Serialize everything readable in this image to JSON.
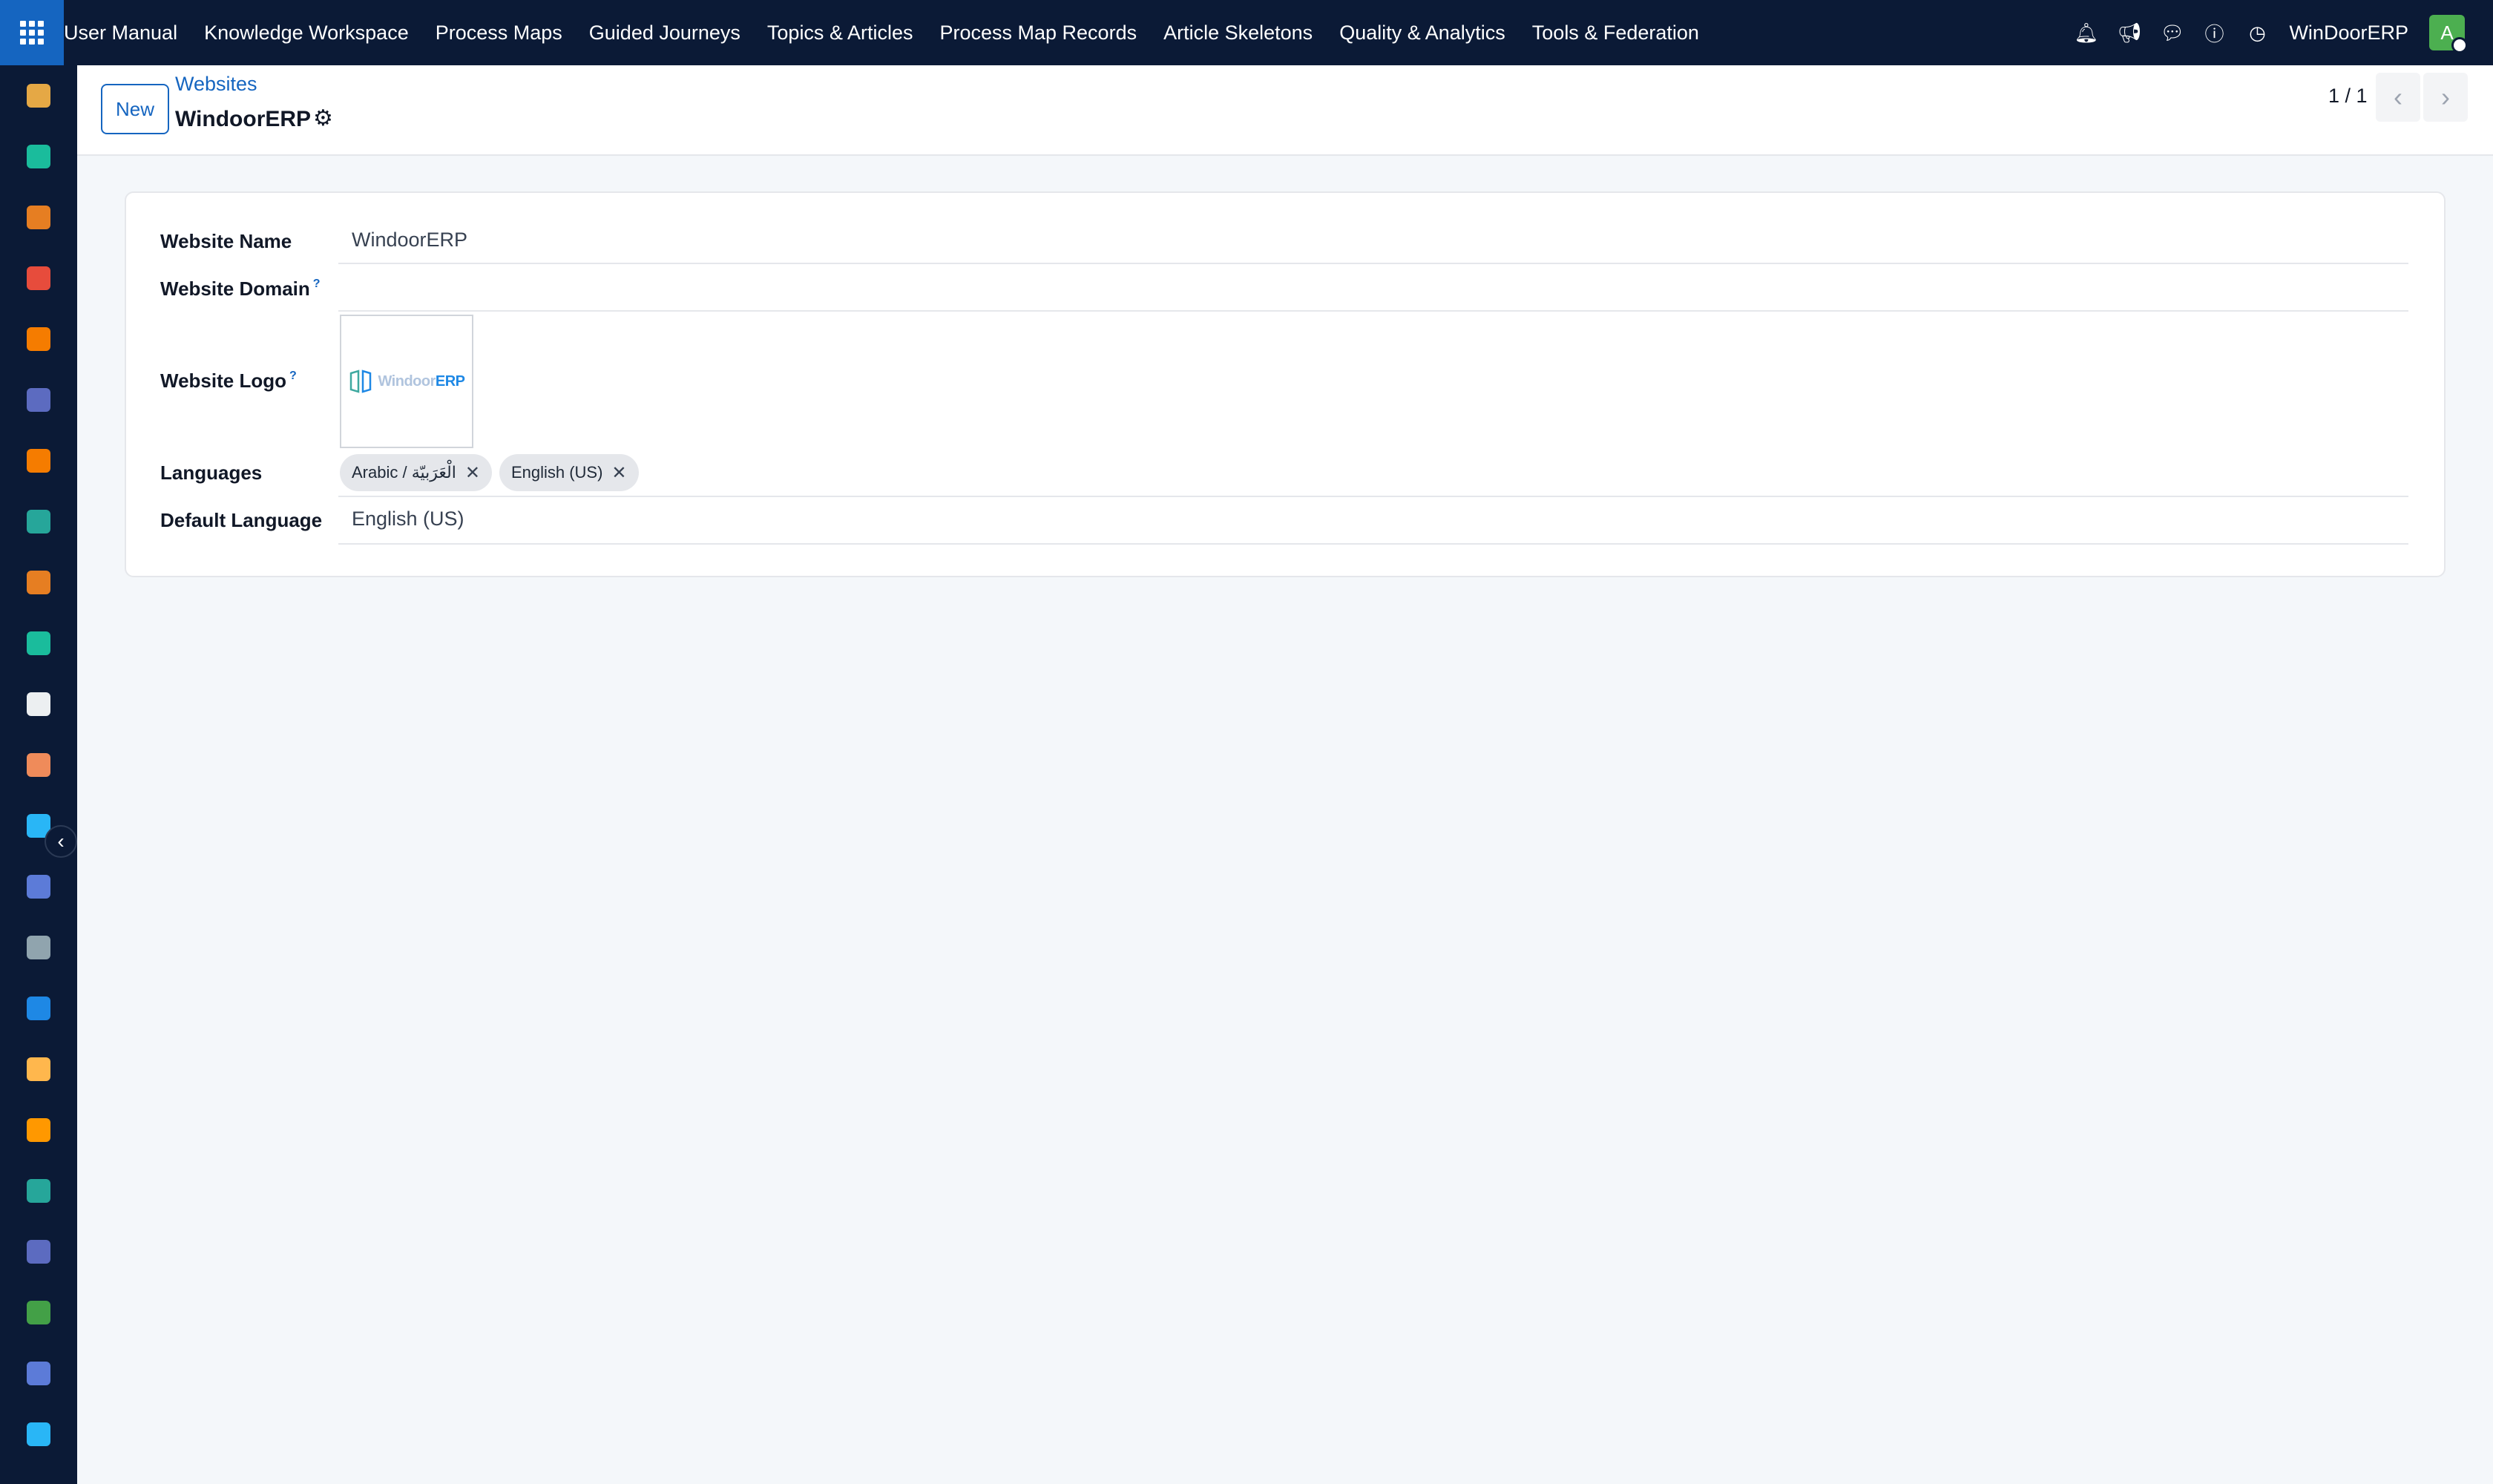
{
  "navbar": {
    "menu": [
      "User Manual",
      "Knowledge Workspace",
      "Process Maps",
      "Guided Journeys",
      "Topics & Articles",
      "Process Map Records",
      "Article Skeletons",
      "Quality & Analytics",
      "Tools & Federation"
    ],
    "company": "WinDoorERP",
    "avatar_letter": "A",
    "icons": [
      "bell-icon",
      "megaphone-icon",
      "chat-icon",
      "help-icon",
      "clock-icon"
    ]
  },
  "sidebar": {
    "apps": [
      {
        "icon": "mixed-app-icon",
        "color": "#e5a845"
      },
      {
        "icon": "contacts-icon",
        "color": "#1abc9c"
      },
      {
        "icon": "reporting-icon",
        "color": "#e67e22"
      },
      {
        "icon": "pie-icon",
        "color": "#e74c3c"
      },
      {
        "icon": "discuss-icon",
        "color": "#f57c00"
      },
      {
        "icon": "mail-icon",
        "color": "#5c6bc0"
      },
      {
        "icon": "livechat-icon",
        "color": "#f57c00"
      },
      {
        "icon": "check-app-icon",
        "color": "#26a69a"
      },
      {
        "icon": "dashboard-icon",
        "color": "#e67e22"
      },
      {
        "icon": "employees-icon",
        "color": "#1abc9c"
      },
      {
        "icon": "inventory-icon",
        "color": "#eceff1"
      },
      {
        "icon": "tools-icon",
        "color": "#ef8b5a"
      },
      {
        "icon": "tasks-icon",
        "color": "#29b6f6"
      },
      {
        "icon": "knowledge-icon",
        "color": "#5c7bd8"
      },
      {
        "icon": "box-icon",
        "color": "#90a4ae"
      },
      {
        "icon": "invoicing-icon",
        "color": "#1e88e5"
      },
      {
        "icon": "team-icon",
        "color": "#ffb74d"
      },
      {
        "icon": "calendar-icon",
        "color": "#ff9800"
      },
      {
        "icon": "sign-icon",
        "color": "#26a69a"
      },
      {
        "icon": "grid-app-icon",
        "color": "#5c6bc0"
      },
      {
        "icon": "whatsapp-icon",
        "color": "#43a047"
      },
      {
        "icon": "timer-icon",
        "color": "#5c7bd8"
      },
      {
        "icon": "website-icon",
        "color": "#29b6f6"
      }
    ]
  },
  "control": {
    "new_label": "New",
    "breadcrumb": "Websites",
    "title": "WindoorERP",
    "pager": "1 / 1"
  },
  "form": {
    "website_name_label": "Website Name",
    "website_name_value": "WindoorERP",
    "website_domain_label": "Website Domain",
    "website_domain_value": "",
    "website_logo_label": "Website Logo",
    "logo_text_a": "Windoor",
    "logo_text_b": "ERP",
    "languages_label": "Languages",
    "languages": [
      "Arabic / الْعَرَبيّة",
      "English (US)"
    ],
    "default_language_label": "Default Language",
    "default_language_value": "English (US)",
    "help_mark": "?"
  },
  "colors": {
    "navbar_bg": "#0b1a36",
    "brand_blue": "#1565c0",
    "avatar_green": "#4caf50"
  }
}
